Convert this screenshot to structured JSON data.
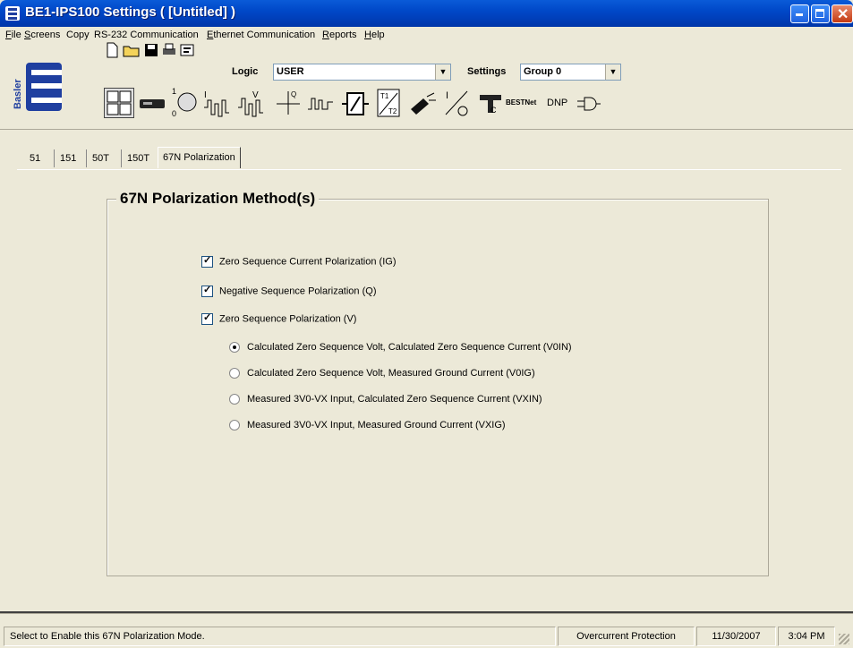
{
  "window": {
    "title": "BE1-IPS100 Settings    ( [Untitled] )"
  },
  "menu": [
    {
      "label": "File",
      "u": "F",
      "rest": "ile"
    },
    {
      "label": "Screens",
      "u": "S",
      "rest": "creens"
    },
    {
      "label": "Copy",
      "u": "",
      "rest": "Copy"
    },
    {
      "label": "RS-232 Communication",
      "u": "",
      "rest": "RS-232 Communication"
    },
    {
      "label": "Ethernet Communication",
      "u": "E",
      "rest": "thernet Communication"
    },
    {
      "label": "Reports",
      "u": "R",
      "rest": "eports"
    },
    {
      "label": "Help",
      "u": "H",
      "rest": "elp"
    }
  ],
  "toolbar": {
    "logic_label": "Logic",
    "logic_value": "USER",
    "settings_label": "Settings",
    "settings_value": "Group 0",
    "bestnet_label": "BESTNet",
    "dnp_label": "DNP",
    "logo_text": "Basler"
  },
  "tabs": [
    "51",
    "151",
    "50T",
    "150T",
    "67N Polarization"
  ],
  "group": {
    "title": "67N Polarization Method(s)",
    "checkboxes": [
      {
        "label": "Zero Sequence Current Polarization (IG)",
        "checked": true
      },
      {
        "label": "Negative Sequence Polarization (Q)",
        "checked": true
      },
      {
        "label": "Zero Sequence Polarization (V)",
        "checked": true
      }
    ],
    "radios": [
      {
        "label": "Calculated Zero Sequence Volt, Calculated Zero Sequence Current (V0IN)",
        "selected": true
      },
      {
        "label": "Calculated Zero Sequence Volt, Measured Ground Current (V0IG)",
        "selected": false
      },
      {
        "label": "Measured 3V0-VX Input, Calculated Zero Sequence Current (VXIN)",
        "selected": false
      },
      {
        "label": "Measured 3V0-VX Input, Measured Ground Current (VXIG)",
        "selected": false
      }
    ]
  },
  "status": {
    "message": "Select to Enable this 67N Polarization Mode.",
    "mode": "Overcurrent Protection",
    "date": "11/30/2007",
    "time": "3:04 PM"
  },
  "colors": {
    "titlebar": "#0048c8",
    "face": "#ece9d8",
    "logo_blue": "#1f3fa0"
  }
}
